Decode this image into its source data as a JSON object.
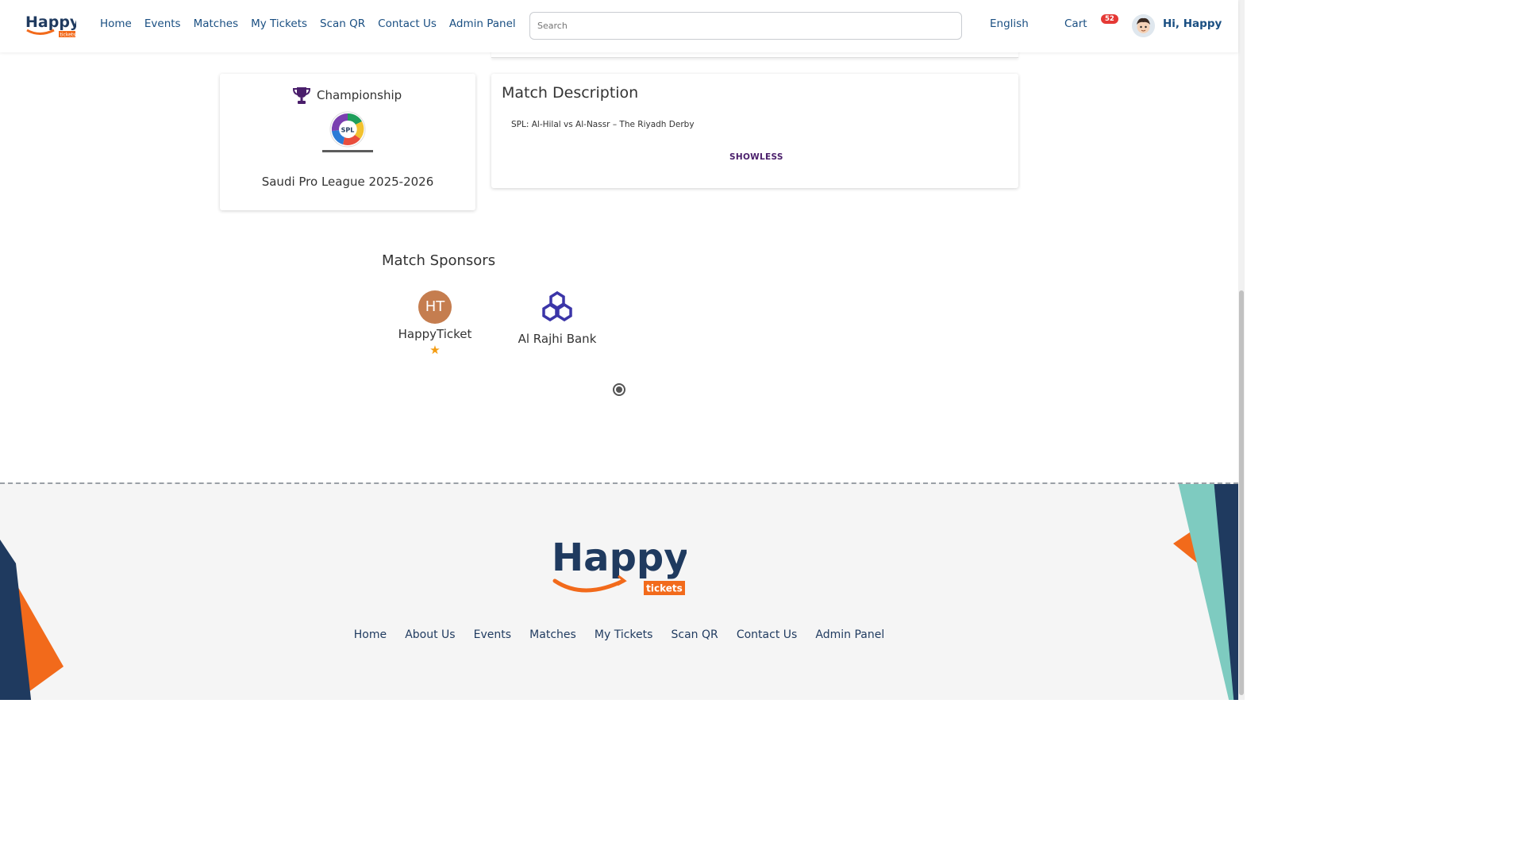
{
  "nav": {
    "logo_text": "Happy",
    "logo_subtext": "tickets",
    "links": [
      "Home",
      "Events",
      "Matches",
      "My Tickets",
      "Scan QR",
      "Contact Us",
      "Admin Panel"
    ],
    "search_placeholder": "Search",
    "language": "English",
    "cart_label": "Cart",
    "cart_count": "52",
    "greeting": "Hi, Happy"
  },
  "championship": {
    "heading": "Championship",
    "league": "Saudi Pro League 2025-2026",
    "logo_text": "SPL"
  },
  "description": {
    "title": "Match Description",
    "text": "SPL: Al-Hilal vs Al-Nassr – The Riyadh Derby",
    "toggle_label": "SHOWLESS"
  },
  "sponsors": {
    "title": "Match Sponsors",
    "items": [
      {
        "initials": "HT",
        "name": "HappyTicket",
        "featured": "★"
      },
      {
        "name": "Al Rajhi Bank"
      }
    ]
  },
  "footer": {
    "logo_text": "Happy",
    "logo_subtext": "tickets",
    "links": [
      "Home",
      "About Us",
      "Events",
      "Matches",
      "My Tickets",
      "Scan QR",
      "Contact Us",
      "Admin Panel"
    ]
  },
  "colors": {
    "brand_navy": "#1f3a5f",
    "brand_orange": "#f26a1b",
    "nav_link": "#1a4f82",
    "badge": "#e53935",
    "trophy": "#4a1e6b"
  }
}
